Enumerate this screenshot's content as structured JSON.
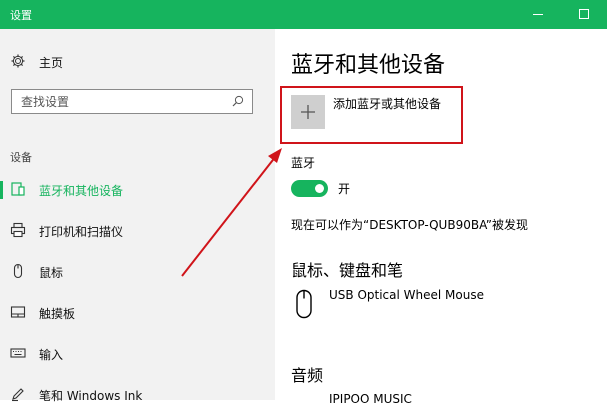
{
  "window": {
    "title": "设置"
  },
  "sidebar": {
    "home_label": "主页",
    "search_placeholder": "查找设置",
    "section_label": "设备",
    "items": [
      {
        "label": "蓝牙和其他设备",
        "icon": "devices-icon",
        "active": true
      },
      {
        "label": "打印机和扫描仪",
        "icon": "printer-icon"
      },
      {
        "label": "鼠标",
        "icon": "mouse-icon"
      },
      {
        "label": "触摸板",
        "icon": "touchpad-icon"
      },
      {
        "label": "输入",
        "icon": "keyboard-icon"
      },
      {
        "label": "笔和 Windows Ink",
        "icon": "pen-icon"
      }
    ]
  },
  "main": {
    "title": "蓝牙和其他设备",
    "add_device_label": "添加蓝牙或其他设备",
    "bluetooth_label": "蓝牙",
    "toggle_state": "开",
    "discoverable_text": "现在可以作为“DESKTOP-QUB90BA”被发现",
    "mouse_section_title": "鼠标、键盘和笔",
    "mouse_device_name": "USB Optical Wheel Mouse",
    "audio_section_title": "音频",
    "audio_device_name": "IPIPOO MUSIC"
  },
  "colors": {
    "accent": "#16b45e",
    "annotation": "#d0141a"
  }
}
